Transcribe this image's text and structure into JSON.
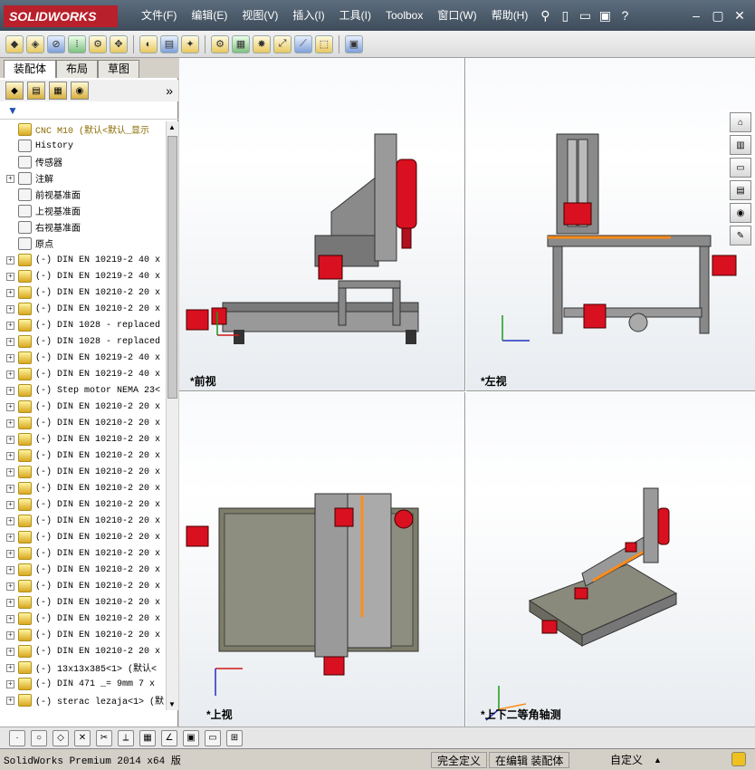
{
  "app": {
    "logo": "SOLIDWORKS"
  },
  "menu": [
    "文件(F)",
    "编辑(E)",
    "视图(V)",
    "插入(I)",
    "工具(I)",
    "Toolbox",
    "窗口(W)",
    "帮助(H)"
  ],
  "panel_tabs": [
    "装配体",
    "布局",
    "草图"
  ],
  "tree": [
    {
      "label": "CNC M10  (默认<默认_显示",
      "expander": false,
      "icon": "assembly-icon"
    },
    {
      "label": "History",
      "expander": false,
      "icon": "history-icon"
    },
    {
      "label": "传感器",
      "expander": false,
      "icon": "sensor-icon"
    },
    {
      "label": "注解",
      "expander": true,
      "icon": "annotation-icon"
    },
    {
      "label": "前视基准面",
      "expander": false,
      "icon": "plane-icon"
    },
    {
      "label": "上视基准面",
      "expander": false,
      "icon": "plane-icon"
    },
    {
      "label": "右视基准面",
      "expander": false,
      "icon": "plane-icon"
    },
    {
      "label": "原点",
      "expander": false,
      "icon": "origin-icon"
    },
    {
      "label": "(-) DIN EN 10219-2 40 x",
      "expander": true,
      "icon": "part-icon"
    },
    {
      "label": "(-) DIN EN 10219-2 40 x",
      "expander": true,
      "icon": "part-icon"
    },
    {
      "label": "(-) DIN EN 10210-2 20 x",
      "expander": true,
      "icon": "part-icon"
    },
    {
      "label": "(-) DIN EN 10210-2 20 x",
      "expander": true,
      "icon": "part-icon"
    },
    {
      "label": "(-) DIN 1028 - replaced",
      "expander": true,
      "icon": "part-icon"
    },
    {
      "label": "(-) DIN 1028 - replaced",
      "expander": true,
      "icon": "part-icon"
    },
    {
      "label": "(-) DIN EN 10219-2 40 x",
      "expander": true,
      "icon": "part-icon"
    },
    {
      "label": "(-) DIN EN 10219-2 40 x",
      "expander": true,
      "icon": "part-icon"
    },
    {
      "label": "(-) Step motor NEMA 23<",
      "expander": true,
      "icon": "part-icon"
    },
    {
      "label": "(-) DIN EN 10210-2 20 x",
      "expander": true,
      "icon": "part-icon"
    },
    {
      "label": "(-) DIN EN 10210-2 20 x",
      "expander": true,
      "icon": "part-icon"
    },
    {
      "label": "(-) DIN EN 10210-2 20 x",
      "expander": true,
      "icon": "part-icon"
    },
    {
      "label": "(-) DIN EN 10210-2 20 x",
      "expander": true,
      "icon": "part-icon"
    },
    {
      "label": "(-) DIN EN 10210-2 20 x",
      "expander": true,
      "icon": "part-icon"
    },
    {
      "label": "(-) DIN EN 10210-2 20 x",
      "expander": true,
      "icon": "part-icon"
    },
    {
      "label": "(-) DIN EN 10210-2 20 x",
      "expander": true,
      "icon": "part-icon"
    },
    {
      "label": "(-) DIN EN 10210-2 20 x",
      "expander": true,
      "icon": "part-icon"
    },
    {
      "label": "(-) DIN EN 10210-2 20 x",
      "expander": true,
      "icon": "part-icon"
    },
    {
      "label": "(-) DIN EN 10210-2 20 x",
      "expander": true,
      "icon": "part-icon"
    },
    {
      "label": "(-) DIN EN 10210-2 20 x",
      "expander": true,
      "icon": "part-icon"
    },
    {
      "label": "(-) DIN EN 10210-2 20 x",
      "expander": true,
      "icon": "part-icon"
    },
    {
      "label": "(-) DIN EN 10210-2 20 x",
      "expander": true,
      "icon": "part-icon"
    },
    {
      "label": "(-) DIN EN 10210-2 20 x",
      "expander": true,
      "icon": "part-icon"
    },
    {
      "label": "(-) DIN EN 10210-2 20 x",
      "expander": true,
      "icon": "part-icon"
    },
    {
      "label": "(-) DIN EN 10210-2 20 x",
      "expander": true,
      "icon": "part-icon"
    },
    {
      "label": "(-) 13x13x385<1> (默认<",
      "expander": true,
      "icon": "part-icon"
    },
    {
      "label": "(-) DIN 471  _= 9mm 7 x",
      "expander": true,
      "icon": "part-icon"
    },
    {
      "label": "(-) sterac lezaja<1> (默",
      "expander": true,
      "icon": "part-icon"
    }
  ],
  "views": {
    "front": "*前视",
    "left": "*左视",
    "top": "*上视",
    "iso": "*上下二等角轴测"
  },
  "status": {
    "version": "SolidWorks Premium 2014 x64 版",
    "definition": "完全定义",
    "editing": "在编辑 装配体",
    "units": "自定义"
  },
  "colors": {
    "accent": "#b8202b",
    "motor": "#d81020",
    "highlight": "#ff8c1a",
    "frame": "#7a7a7a"
  }
}
